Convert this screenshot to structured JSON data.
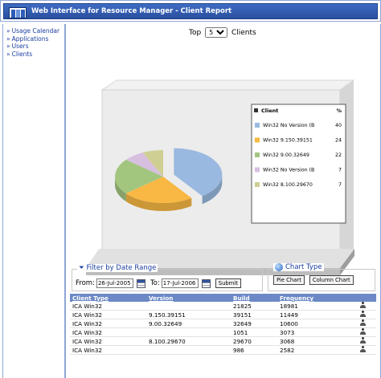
{
  "window": {
    "title": "Web Interface for Resource Manager - Client Report",
    "app_icon": "bar-chart-icon"
  },
  "sidebar": {
    "items": [
      {
        "label": "Usage Calendar"
      },
      {
        "label": "Applications"
      },
      {
        "label": "Users"
      },
      {
        "label": "Clients"
      }
    ]
  },
  "top_selector": {
    "prefix": "Top",
    "value": "5",
    "suffix": "Clients"
  },
  "chart_data": {
    "type": "pie",
    "legend_header": "Client",
    "legend_pct_header": "%",
    "legend_position": "right",
    "slices": [
      {
        "label": "Win32  No Version (B",
        "value": 40,
        "color": "#9ab9e0"
      },
      {
        "label": "Win32 9.150.39151",
        "value": 24,
        "color": "#f9b843"
      },
      {
        "label": "Win32 9.00.32649",
        "value": 22,
        "color": "#a3c67f"
      },
      {
        "label": "Win32  No Version (B",
        "value": 7,
        "color": "#d7bfe0"
      },
      {
        "label": "Win32 8.100.29670",
        "value": 7,
        "color": "#cfcf94"
      }
    ]
  },
  "filter": {
    "title": "Filter by Date Range",
    "from_label": "From:",
    "from_value": "26-Jul-2005",
    "to_label": "To:",
    "to_value": "17-Jul-2006",
    "submit_label": "Submit"
  },
  "chart_type": {
    "title": "Chart Type",
    "pie_label": "Pie Chart",
    "column_label": "Column Chart"
  },
  "table": {
    "headers": [
      "Client Type",
      "Version",
      "Build",
      "Frequency"
    ],
    "rows": [
      [
        "ICA Win32",
        "",
        "21825",
        "18981"
      ],
      [
        "ICA Win32",
        "9.150.39151",
        "39151",
        "11449"
      ],
      [
        "ICA Win32",
        "9.00.32649",
        "32649",
        "10600"
      ],
      [
        "ICA Win32",
        "",
        "1051",
        "3073"
      ],
      [
        "ICA Win32",
        "8.100.29670",
        "29670",
        "3068"
      ],
      [
        "ICA Win32",
        "",
        "986",
        "2582"
      ]
    ]
  }
}
